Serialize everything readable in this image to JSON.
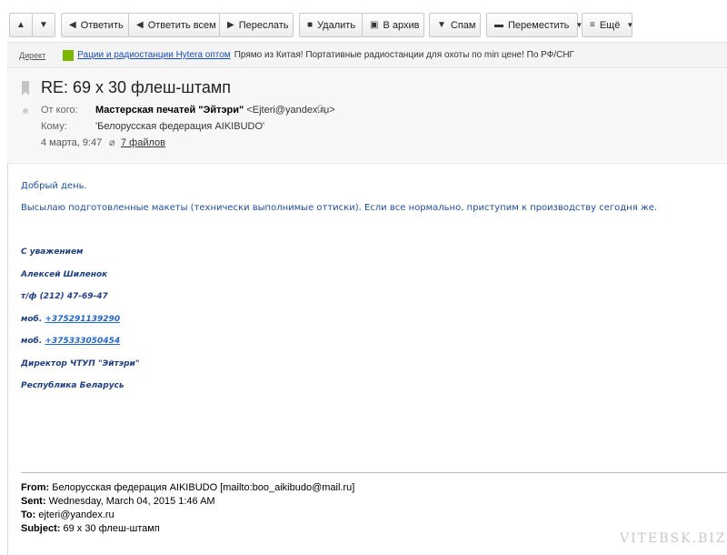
{
  "toolbar": {
    "up_icon": "arrow-up-icon",
    "down_icon": "arrow-down-icon",
    "reply": "Ответить",
    "reply_all": "Ответить всем",
    "forward": "Переслать",
    "delete": "Удалить",
    "archive": "В архив",
    "spam": "Спам",
    "move": "Переместить",
    "more": "Ещё"
  },
  "ad": {
    "direct_label": "Директ",
    "link_text": "Рации и радиостанции Hytera оптом",
    "text": "Прямо из Китая! Портативные радиостанции для охоты по min цене! По РФ/СНГ"
  },
  "message": {
    "subject": "RE: 69 x 30 флеш-штамп",
    "from_label": "От кого:",
    "from_name": "Мастерская печатей \"Эйтэри\"",
    "from_email": "<Ejteri@yandex.ru>",
    "to_label": "Кому:",
    "to_value": "'Белорусская федерация AIKIBUDO'",
    "date": "4 марта, 9:47",
    "attachments": "7 файлов"
  },
  "body": {
    "greeting": "Добрый день.",
    "text": "Высылаю подготовленные макеты (технически выполнимые оттиски). Если все нормально, приступим к производству сегодня же."
  },
  "signature": {
    "regards": "С уважением",
    "name": "Алексей Шиленок",
    "phone": "т/ф (212) 47-69-47",
    "mob1_label": "моб.",
    "mob1": "+375291139290",
    "mob2_label": "моб.",
    "mob2": "+375333050454",
    "position": "Директор ЧТУП \"Эйтэри\"",
    "country": "Республика Беларусь"
  },
  "forwarded": {
    "from_label": "From:",
    "from_value": "Белорусская федерация AIKIBUDO [mailto:boo_aikibudo@mail.ru]",
    "sent_label": "Sent:",
    "sent_value": "Wednesday, March 04, 2015 1:46 AM",
    "to_label": "To:",
    "to_value": "ejteri@yandex.ru",
    "subject_label": "Subject:",
    "subject_value": "69 x 30 флеш-штамп"
  },
  "watermark": "VITEBSK.BIZ"
}
